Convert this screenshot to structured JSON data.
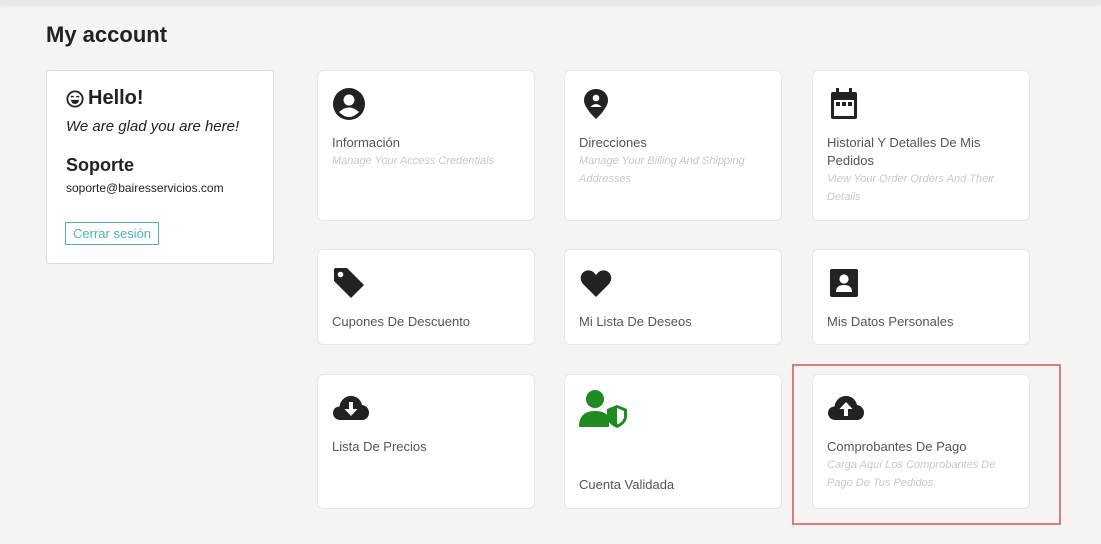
{
  "page": {
    "title": "My account"
  },
  "user_card": {
    "greeting": "Hello!",
    "tagline": "We are glad you are here!",
    "name": "Soporte",
    "email": "soporte@bairesservicios.com",
    "logout_label": "Cerrar sesión"
  },
  "tiles": [
    {
      "icon": "account-circle-icon",
      "title": "Información",
      "subtitle": "Manage Your Access Credentials"
    },
    {
      "icon": "map-pin-icon",
      "title": "Direcciones",
      "subtitle": "Manage Your Billing And Shipping Addresses"
    },
    {
      "icon": "calendar-icon",
      "title": "Historial Y Detalles De Mis Pedidos",
      "subtitle": "View Your Order Orders And Their Details"
    },
    {
      "icon": "tag-icon",
      "title": "Cupones De Descuento",
      "subtitle": ""
    },
    {
      "icon": "heart-icon",
      "title": "Mi Lista De Deseos",
      "subtitle": ""
    },
    {
      "icon": "contact-card-icon",
      "title": "Mis Datos Personales",
      "subtitle": ""
    },
    {
      "icon": "cloud-download-icon",
      "title": "Lista De Precios",
      "subtitle": ""
    },
    {
      "icon": "user-shield-icon",
      "title": "Cuenta Validada",
      "subtitle": ""
    },
    {
      "icon": "cloud-upload-icon",
      "title": "Comprobantes De Pago",
      "subtitle": "Carga Aquí Los Comprobantes De Pago De Tus Pedidos."
    }
  ],
  "colors": {
    "accent": "#4fb0bd",
    "verified_green": "#1f8a1f",
    "highlight_border": "#e07a7a",
    "icon_dark": "#222222"
  }
}
